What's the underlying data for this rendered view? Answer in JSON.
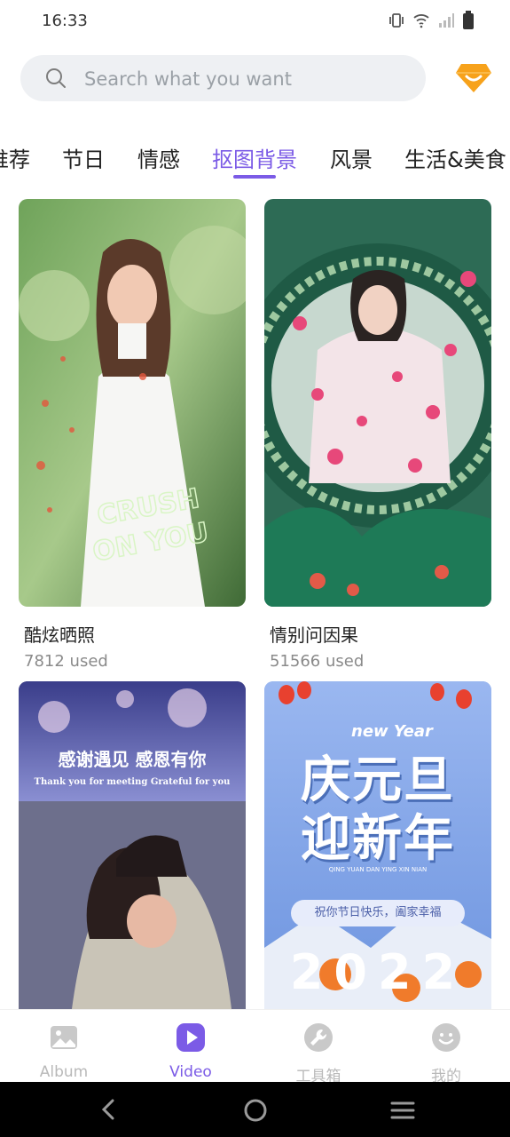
{
  "status": {
    "time": "16:33"
  },
  "search": {
    "placeholder": "Search what you want"
  },
  "tabs": [
    {
      "label": "推荐"
    },
    {
      "label": "节日"
    },
    {
      "label": "情感"
    },
    {
      "label": "抠图背景"
    },
    {
      "label": "风景"
    },
    {
      "label": "生活&美食"
    }
  ],
  "cards": [
    {
      "title": "酷炫晒照",
      "meta": "7812 used",
      "image_text": "CRUSH ON YOU"
    },
    {
      "title": "情别问因果",
      "meta": "51566 used"
    },
    {
      "banner_cn": "感谢遇见 感恩有你",
      "banner_en": "Thank you for meeting  Grateful for you"
    },
    {
      "top_en": "new Year",
      "big_line1": "庆元旦",
      "big_line2": "迎新年",
      "pinyin": "QING YUAN DAN YING XIN NIAN",
      "ribbon": "祝你节日快乐，阖家幸福",
      "year": "2022"
    }
  ],
  "nav": [
    {
      "label": "Album"
    },
    {
      "label": "Video"
    },
    {
      "label": "工具箱"
    },
    {
      "label": "我的"
    }
  ],
  "colors": {
    "accent": "#7b5be6",
    "vip": "#f7a21b"
  }
}
